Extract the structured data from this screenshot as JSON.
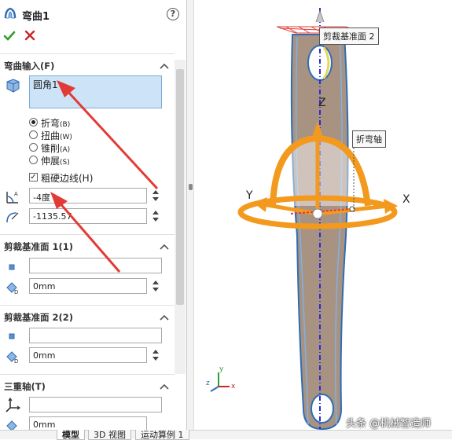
{
  "feature": {
    "title": "弯曲1",
    "help_label": "?",
    "ok_label": "确定",
    "cancel_label": "取消"
  },
  "bend_input": {
    "title": "弯曲输入(F)",
    "selection": "圆角1",
    "options": [
      {
        "label": "折弯",
        "key": "(B)",
        "selected": true
      },
      {
        "label": "扭曲",
        "key": "(W)",
        "selected": false
      },
      {
        "label": "锥削",
        "key": "(A)",
        "selected": false
      },
      {
        "label": "伸展",
        "key": "(S)",
        "selected": false
      }
    ],
    "rigid_edges_label": "粗硬边线(H)",
    "rigid_edges_checked": true,
    "angle_value": "-4度",
    "radius_value": "-1135.57"
  },
  "trim_plane_1": {
    "title": "剪裁基准面 1(1)",
    "selection": "",
    "distance": "0mm"
  },
  "trim_plane_2": {
    "title": "剪裁基准面 2(2)",
    "selection": "",
    "distance": "0mm"
  },
  "triad": {
    "title": "三重轴(T)",
    "selection": "",
    "distance": "0mm"
  },
  "viewport": {
    "trim_plane_tag": "剪裁基准面 2",
    "bend_axis_tag": "折弯轴",
    "axis_x": "X",
    "axis_y": "Y",
    "axis_z": "Z",
    "triad_x": "x",
    "triad_y": "y",
    "triad_z": "z"
  },
  "tabs": [
    {
      "label": "模型",
      "active": true
    },
    {
      "label": "3D 视图",
      "active": false
    },
    {
      "label": "运动算例 1",
      "active": false
    }
  ],
  "watermark": "头条 @机械智造师",
  "colors": {
    "selection_fill": "#cde4f8",
    "ok_green": "#2e9d2e",
    "cancel_red": "#c62828",
    "part_fill": "#a89383",
    "handle_orange": "#f39a1e",
    "annotation_red": "#e23b36"
  }
}
